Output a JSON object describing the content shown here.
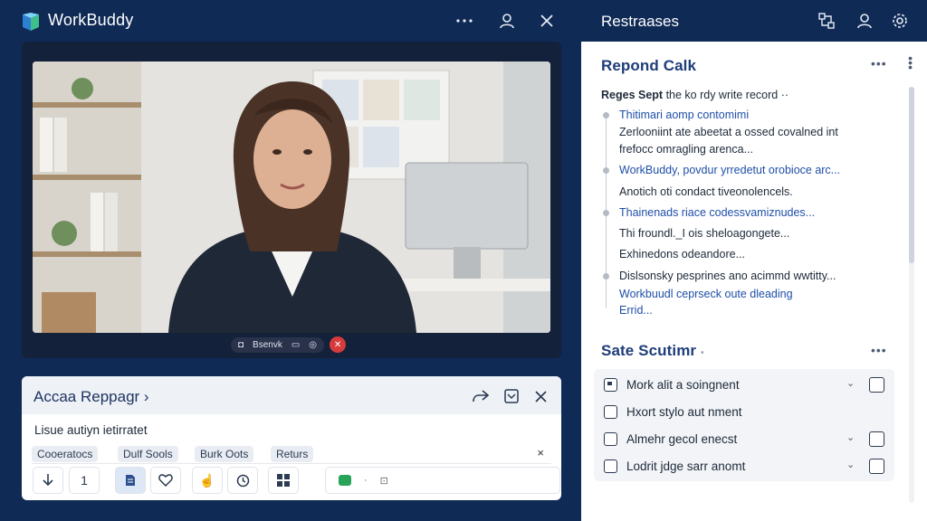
{
  "app": {
    "title": "WorkBuddy",
    "brand_color": "#2d7fd1"
  },
  "topbar": {
    "icons": [
      "more-icon",
      "user-icon",
      "close-icon"
    ]
  },
  "video": {
    "controls": {
      "label": "Bsenvk",
      "end_call_symbol": "✕"
    }
  },
  "bottom_card": {
    "title": "Accaa Reppagr",
    "text": "Lisue autiyn ietirratet",
    "chips": [
      "Cooeratocs",
      "Dulf Sools",
      "Burk Oots",
      "Returs"
    ],
    "chip_close": "×",
    "tools": {
      "two": "1"
    }
  },
  "right_header": {
    "title": "Restraases"
  },
  "respond": {
    "title": "Repond Calk",
    "subhead_bold": "Reges Sept",
    "subhead_rest": " the ko rdy write record ··",
    "timeline": [
      {
        "text": "Thitimari aomp contomimi",
        "link": true
      },
      {
        "text": "Zerlooniint ate abeetat a ossed covalned int",
        "link": false
      },
      {
        "text": "frefocc omragling arenca...",
        "link": false
      },
      {
        "text": "WorkBuddy, povdur yrredetut orobioce arc...",
        "link": true
      },
      {
        "text": "Anotich oti condact tiveonolencels.",
        "link": false
      },
      {
        "text": "Thainenads riace codessvamiznudes...",
        "link": true
      },
      {
        "text": "Thi froundl._I ois sheloagongete...",
        "link": false
      },
      {
        "text": "Exhinedons odeandore...",
        "link": false
      },
      {
        "text": "Dislsonsky pesprines ano acimmd wwtitty...",
        "link": false
      },
      {
        "text": "Workbuudl ceprseck oute dleading",
        "link": true
      },
      {
        "text": "Errid...",
        "link": true
      }
    ]
  },
  "state": {
    "title": "Sate Scutimr",
    "items": [
      {
        "label": "Mork alit a soingnent",
        "chevron": "⌄"
      },
      {
        "label": "Hxort stylo aut nment",
        "chevron": ""
      },
      {
        "label": "Almehr gecol enecst",
        "chevron": "⌄"
      },
      {
        "label": "Lodrit jdge sarr anomt",
        "chevron": "⌄"
      }
    ]
  }
}
